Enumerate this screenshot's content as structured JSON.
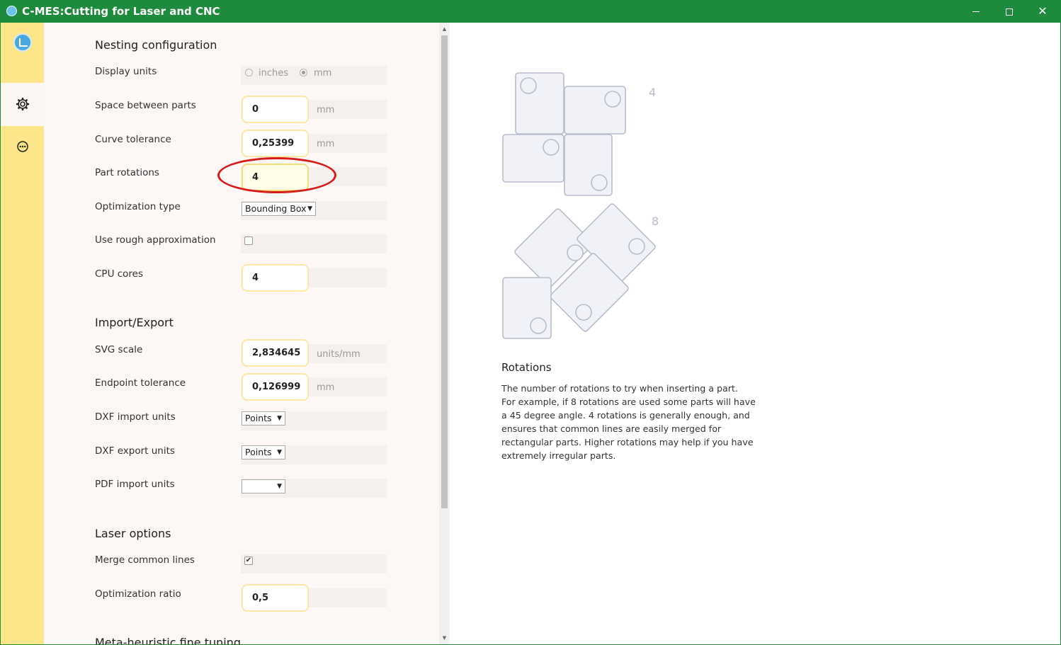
{
  "window": {
    "title": "C-MES:Cutting for Laser and CNC",
    "minimize_label": "",
    "maximize_label": "",
    "close_label": "✕"
  },
  "sidebar": {
    "items": [
      {
        "name": "logo",
        "icon": "app-logo-icon"
      },
      {
        "name": "settings",
        "icon": "gear-icon",
        "active": true
      },
      {
        "name": "info",
        "icon": "info-icon"
      }
    ]
  },
  "nesting": {
    "title": "Nesting configuration",
    "display_units": {
      "label": "Display units",
      "options": [
        "inches",
        "mm"
      ],
      "selected": "mm"
    },
    "space_between_parts": {
      "label": "Space between parts",
      "value": "0",
      "unit": "mm"
    },
    "curve_tolerance": {
      "label": "Curve tolerance",
      "value": "0,25399",
      "unit": "mm"
    },
    "part_rotations": {
      "label": "Part rotations",
      "value": "4"
    },
    "optimization_type": {
      "label": "Optimization type",
      "value": "Bounding Box"
    },
    "rough_approx": {
      "label": "Use rough approximation",
      "checked": false
    },
    "cpu_cores": {
      "label": "CPU cores",
      "value": "4"
    }
  },
  "import_export": {
    "title": "Import/Export",
    "svg_scale": {
      "label": "SVG scale",
      "value": "2,834645",
      "unit": "units/mm"
    },
    "endpoint_tolerance": {
      "label": "Endpoint tolerance",
      "value": "0,126999",
      "unit": "mm"
    },
    "dxf_import_units": {
      "label": "DXF import units",
      "value": "Points"
    },
    "dxf_export_units": {
      "label": "DXF export units",
      "value": "Points"
    },
    "pdf_import_units": {
      "label": "PDF import units",
      "value": ""
    }
  },
  "laser": {
    "title": "Laser options",
    "merge_common_lines": {
      "label": "Merge common lines",
      "checked": true
    },
    "optimization_ratio": {
      "label": "Optimization ratio",
      "value": "0,5"
    }
  },
  "meta": {
    "title": "Meta-heuristic fine tuning"
  },
  "help": {
    "diagram_labels": {
      "four": "4",
      "eight": "8"
    },
    "title": "Rotations",
    "lines": [
      "The number of rotations to try when inserting a part.",
      "For example, if 8 rotations are used some parts will have",
      "a 45 degree angle. 4 rotations is generally enough, and",
      "ensures that common lines are easily merged for",
      "rectangular parts. Higher rotations may help if you have",
      "extremely irregular parts."
    ]
  },
  "colors": {
    "titlebar": "#1e8a3c",
    "sidebar": "#fde58a",
    "panel": "#fdf7f6",
    "input_border": "#fce8a4",
    "annotation": "#d61b1b",
    "diagram_stroke": "#b8bccb",
    "diagram_fill": "#f1f2f8"
  }
}
